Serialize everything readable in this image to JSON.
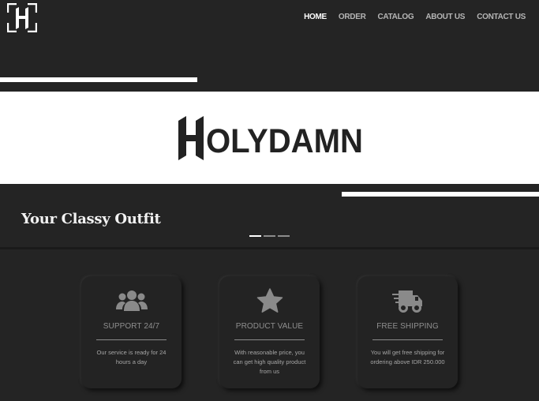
{
  "brand": {
    "logo_alt": "H",
    "wordmark": "HOLYDAMN"
  },
  "nav": {
    "items": [
      {
        "label": "HOME",
        "active": true
      },
      {
        "label": "ORDER",
        "active": false
      },
      {
        "label": "CATALOG",
        "active": false
      },
      {
        "label": "ABOUT US",
        "active": false
      },
      {
        "label": "CONTACT US",
        "active": false
      }
    ]
  },
  "hero": {
    "tagline": "Your Classy Outfit",
    "carousel": {
      "slides": 3,
      "active_index": 0
    }
  },
  "features": [
    {
      "icon": "users-icon",
      "title": "SUPPORT 24/7",
      "description": "Our service is ready for 24 hours a day"
    },
    {
      "icon": "star-icon",
      "title": "PRODUCT VALUE",
      "description": "With reasonable price, you can get high quality product from us"
    },
    {
      "icon": "shipping-truck-icon",
      "title": "FREE SHIPPING",
      "description": "You will get free shipping for ordering above IDR 250.000"
    }
  ],
  "colors": {
    "background": "#242424",
    "hero_band": "#ffffff",
    "card_title": "#8f8f8f",
    "card_icon": "#8a8a8a"
  }
}
